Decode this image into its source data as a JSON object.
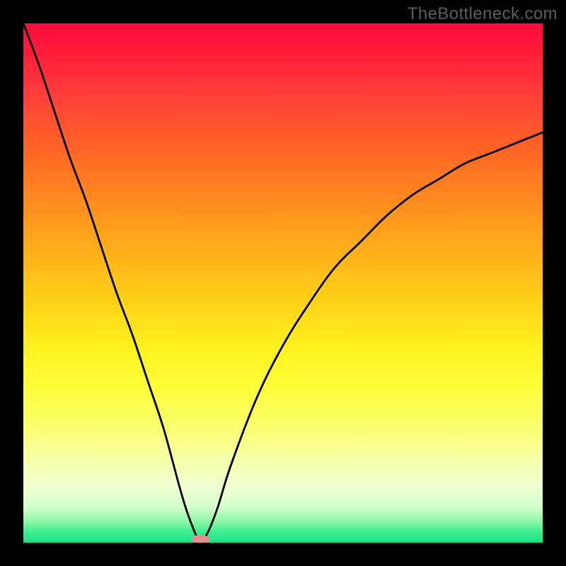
{
  "watermark": "TheBottleneck.com",
  "chart_data": {
    "type": "line",
    "title": "",
    "xlabel": "",
    "ylabel": "",
    "xlim": [
      0,
      100
    ],
    "ylim": [
      0,
      100
    ],
    "x": [
      0,
      3,
      6,
      9,
      12,
      15,
      18,
      21,
      24,
      27,
      30,
      31.5,
      33,
      34,
      34.5,
      35,
      36,
      37.5,
      40,
      45,
      50,
      55,
      60,
      65,
      70,
      75,
      80,
      85,
      90,
      95,
      100
    ],
    "values": [
      100,
      92,
      83,
      74,
      66,
      57,
      48,
      40,
      31,
      22,
      11,
      6,
      2,
      0,
      0,
      1,
      3,
      7,
      15,
      28,
      38,
      46,
      53,
      58,
      63,
      67,
      70,
      73,
      75,
      77,
      79
    ],
    "marker": {
      "x": 34,
      "y": 0.5
    },
    "gradient_stops": [
      {
        "pct": 0,
        "color": "#ff0a3a"
      },
      {
        "pct": 24,
        "color": "#ff6426"
      },
      {
        "pct": 54,
        "color": "#ffd318"
      },
      {
        "pct": 78,
        "color": "#fbff6e"
      },
      {
        "pct": 93,
        "color": "#d6ffcd"
      },
      {
        "pct": 100,
        "color": "#1bdf86"
      }
    ]
  }
}
